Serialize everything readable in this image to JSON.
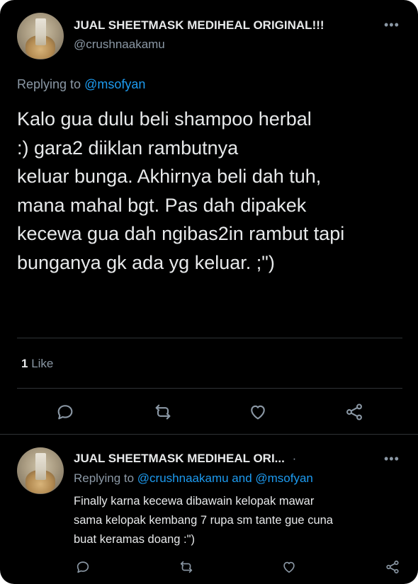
{
  "main_tweet": {
    "author_name": "JUAL SHEETMASK MEDIHEAL ORIGINAL!!!",
    "author_handle": "@crushnaakamu",
    "replying_prefix": "Replying to",
    "replying_to": "@msofyan",
    "text": "Kalo gua dulu beli shampoo herbal\n                  :) gara2 diiklan rambutnya\nkeluar bunga. Akhirnya beli dah tuh,\nmana mahal bgt. Pas dah dipakek\nkecewa gua dah ngibas2in rambut tapi\nbunganya gk ada yg keluar. ;\")",
    "like_count": "1",
    "like_label": "Like"
  },
  "reply_tweet": {
    "author_name": "JUAL SHEETMASK MEDIHEAL ORI...",
    "separator": "·",
    "replying_prefix": "Replying to",
    "replying_to": "@crushnaakamu and @msofyan",
    "text": "Finally karna kecewa dibawain kelopak mawar\nsama kelopak kembang 7 rupa sm tante gue cuna\nbuat keramas doang :\")"
  },
  "icons": {
    "more": "more-dots-icon",
    "reply": "reply-icon",
    "retweet": "retweet-icon",
    "like": "heart-icon",
    "share": "share-icon"
  },
  "colors": {
    "background": "#000000",
    "text": "#e7e9ea",
    "secondary": "#8b98a5",
    "link": "#1d9bf0",
    "divider": "#2f3336"
  }
}
